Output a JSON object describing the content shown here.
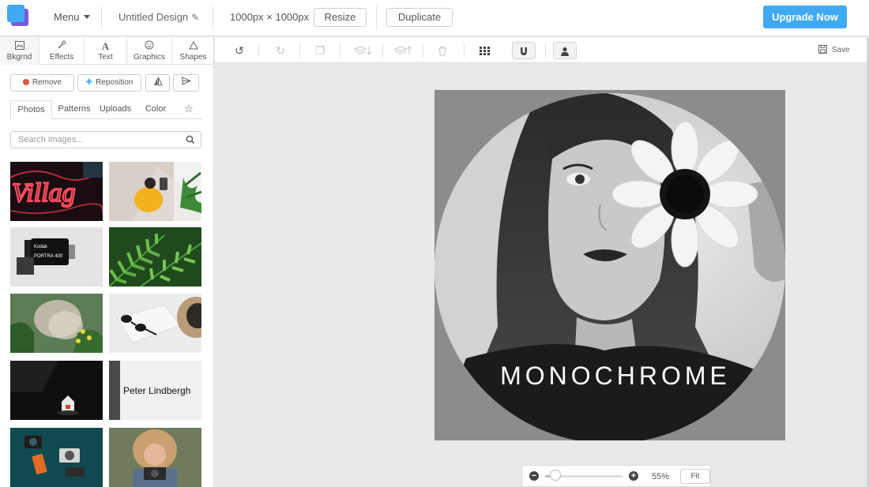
{
  "header": {
    "menu_label": "Menu",
    "design_title": "Untitled Design",
    "dimensions": "1000px × 1000px",
    "resize_label": "Resize",
    "duplicate_label": "Duplicate",
    "upgrade_label": "Upgrade Now"
  },
  "tabs": [
    {
      "label": "Bkgrnd",
      "icon": "image-icon"
    },
    {
      "label": "Effects",
      "icon": "wand-icon"
    },
    {
      "label": "Text",
      "icon": "text-icon"
    },
    {
      "label": "Graphics",
      "icon": "smiley-icon"
    },
    {
      "label": "Shapes",
      "icon": "triangle-icon"
    }
  ],
  "panel": {
    "remove_label": "Remove",
    "reposition_label": "Reposition",
    "subtabs": [
      "Photos",
      "Patterns",
      "Uploads",
      "Color"
    ],
    "search_placeholder": "Search images...",
    "thumb_texts": {
      "neon": "Villag",
      "film_brand": "Kodak",
      "film_type": "PORTRA 400",
      "book": "Peter Lindbergh"
    }
  },
  "toolbar": {
    "save_label": "Save"
  },
  "canvas": {
    "text": "MONOCHROME"
  },
  "zoom": {
    "level": 0.55,
    "value_label": "55%",
    "fit_label": "Fit"
  },
  "colors": {
    "accent": "#3fa9f5",
    "logo_back": "#7b5cd6",
    "remove_red": "#e0534a"
  }
}
